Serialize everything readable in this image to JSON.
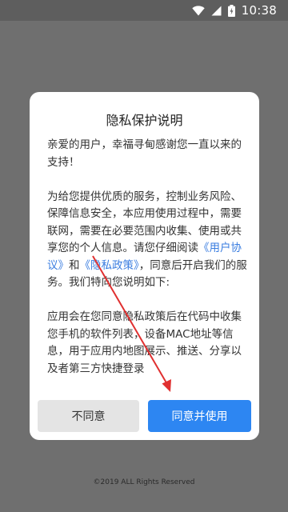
{
  "status_bar": {
    "time": "10:38",
    "icons": [
      "wifi-icon",
      "signal-icon",
      "battery-icon"
    ]
  },
  "dialog": {
    "title": "隐私保护说明",
    "greeting": "亲爱的用户，幸福寻甸感谢您一直以来的支持！",
    "para2_text1": "为给您提供优质的服务，控制业务风险、保障信息安全，本应用使用过程中，需要联网，需要在必要范围内收集、使用或共享您的个人信息。请您仔细阅读",
    "user_agreement_link": "《用户协议》",
    "and_text": "和",
    "privacy_policy_link": "《隐私政策》",
    "para2_text2": "，同意后开启我们的服务。我们特向您说明如下:",
    "para3": "应用会在您同意隐私政策后在代码中收集您手机的软件列表，设备MAC地址等信息，用于应用内地图展示、推送、分享以及者第三方快捷登录",
    "disagree_label": "不同意",
    "agree_label": "同意并使用"
  },
  "footer": {
    "copyright": "©2019 ALL Rights Reserved"
  },
  "colors": {
    "overlay": "#6f6f6f",
    "link": "#3a7de0",
    "agree_button": "#2d86f2",
    "disagree_button": "#e4e4e4",
    "annotation_arrow": "#e03030"
  }
}
